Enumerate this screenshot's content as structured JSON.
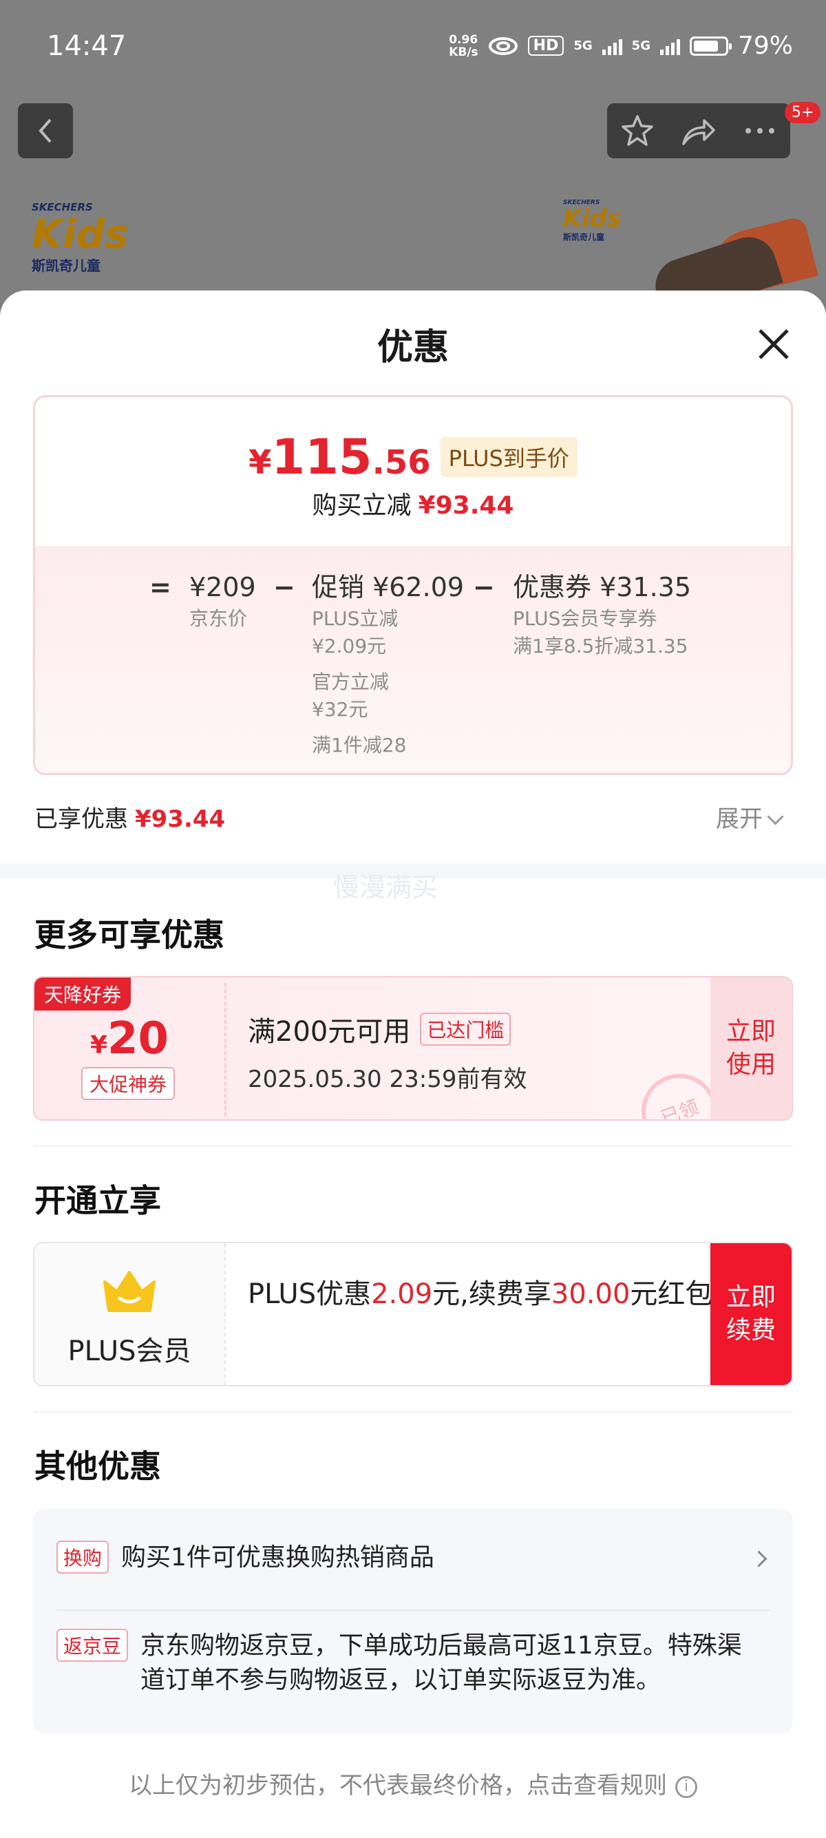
{
  "status_bar": {
    "time": "14:47",
    "net_speed_value": "0.96",
    "net_speed_unit": "KB/s",
    "hd": "HD",
    "signal1": "5G",
    "signal2": "5G",
    "battery_percent": 79,
    "battery_text": "79%"
  },
  "product_page": {
    "notification_count": "5+",
    "brand_small": "SKECHERS",
    "brand_kids": "Kids",
    "brand_cn": "斯凯奇儿童"
  },
  "sheet": {
    "title": "优惠",
    "price_summary": {
      "currency": "¥",
      "final_int": "115",
      "final_dec": ".56",
      "plus_tag": "PLUS到手价",
      "reduce_label": "购买立减",
      "reduce_amount": "¥93.44"
    },
    "calculation": {
      "eq": "=",
      "jd_price": "¥209",
      "jd_price_label": "京东价",
      "minus1": "−",
      "promo_title": "促销 ¥62.09",
      "promo_items": [
        "PLUS立减",
        "¥2.09元",
        "官方立减",
        "¥32元",
        "满1件减28"
      ],
      "minus2": "−",
      "coupon_title": "优惠券 ¥31.35",
      "coupon_items": [
        "PLUS会员专享券",
        "满1享8.5折减31.35"
      ]
    },
    "enjoyed_label": "已享优惠",
    "enjoyed_amount": "¥93.44",
    "expand_label": "展开",
    "watermark": "慢漫满买"
  },
  "more_offers": {
    "title": "更多可享优惠",
    "coupon": {
      "ribbon": "天降好券",
      "symbol": "¥",
      "value": "20",
      "tag": "大促神券",
      "condition": "满200元可用",
      "reached": "已达门槛",
      "expiry": "2025.05.30 23:59前有效",
      "button_line1": "立即",
      "button_line2": "使用",
      "stamp": "已领"
    }
  },
  "membership": {
    "title": "开通立享",
    "label": "PLUS会员",
    "text_pre": "PLUS优惠",
    "amount1": "2.09",
    "text_mid": "元,续费享",
    "amount2": "30.00",
    "text_post": "元红包",
    "button_line1": "立即",
    "button_line2": "续费"
  },
  "other_offers": {
    "title": "其他优惠",
    "items": [
      {
        "tag": "换购",
        "text": "购买1件可优惠换购热销商品"
      },
      {
        "tag": "返京豆",
        "text": "京东购物返京豆，下单成功后最高可返11京豆。特殊渠道订单不参与购物返豆，以订单实际返豆为准。"
      }
    ]
  },
  "footer_note": "以上仅为初步预估，不代表最终价格，点击查看规则",
  "colors": {
    "accent_red": "#e4232e",
    "renew_red": "#f0162b",
    "plus_gold": "#fdf0d6"
  }
}
